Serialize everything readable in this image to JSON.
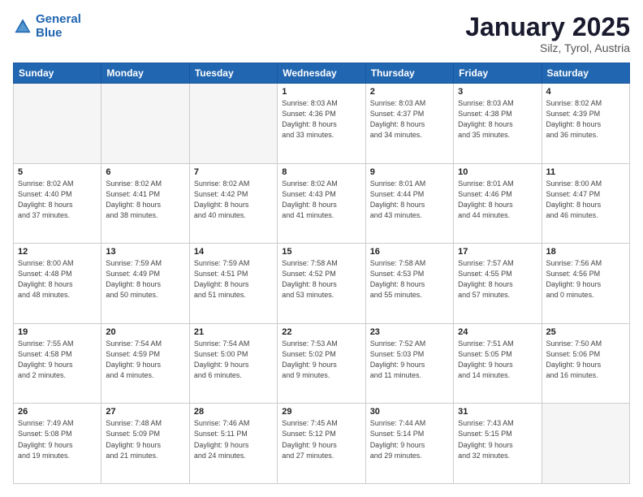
{
  "header": {
    "logo_line1": "General",
    "logo_line2": "Blue",
    "month": "January 2025",
    "location": "Silz, Tyrol, Austria"
  },
  "days_of_week": [
    "Sunday",
    "Monday",
    "Tuesday",
    "Wednesday",
    "Thursday",
    "Friday",
    "Saturday"
  ],
  "weeks": [
    [
      {
        "num": "",
        "detail": "",
        "empty": true
      },
      {
        "num": "",
        "detail": "",
        "empty": true
      },
      {
        "num": "",
        "detail": "",
        "empty": true
      },
      {
        "num": "1",
        "detail": "Sunrise: 8:03 AM\nSunset: 4:36 PM\nDaylight: 8 hours\nand 33 minutes.",
        "empty": false
      },
      {
        "num": "2",
        "detail": "Sunrise: 8:03 AM\nSunset: 4:37 PM\nDaylight: 8 hours\nand 34 minutes.",
        "empty": false
      },
      {
        "num": "3",
        "detail": "Sunrise: 8:03 AM\nSunset: 4:38 PM\nDaylight: 8 hours\nand 35 minutes.",
        "empty": false
      },
      {
        "num": "4",
        "detail": "Sunrise: 8:02 AM\nSunset: 4:39 PM\nDaylight: 8 hours\nand 36 minutes.",
        "empty": false
      }
    ],
    [
      {
        "num": "5",
        "detail": "Sunrise: 8:02 AM\nSunset: 4:40 PM\nDaylight: 8 hours\nand 37 minutes.",
        "empty": false
      },
      {
        "num": "6",
        "detail": "Sunrise: 8:02 AM\nSunset: 4:41 PM\nDaylight: 8 hours\nand 38 minutes.",
        "empty": false
      },
      {
        "num": "7",
        "detail": "Sunrise: 8:02 AM\nSunset: 4:42 PM\nDaylight: 8 hours\nand 40 minutes.",
        "empty": false
      },
      {
        "num": "8",
        "detail": "Sunrise: 8:02 AM\nSunset: 4:43 PM\nDaylight: 8 hours\nand 41 minutes.",
        "empty": false
      },
      {
        "num": "9",
        "detail": "Sunrise: 8:01 AM\nSunset: 4:44 PM\nDaylight: 8 hours\nand 43 minutes.",
        "empty": false
      },
      {
        "num": "10",
        "detail": "Sunrise: 8:01 AM\nSunset: 4:46 PM\nDaylight: 8 hours\nand 44 minutes.",
        "empty": false
      },
      {
        "num": "11",
        "detail": "Sunrise: 8:00 AM\nSunset: 4:47 PM\nDaylight: 8 hours\nand 46 minutes.",
        "empty": false
      }
    ],
    [
      {
        "num": "12",
        "detail": "Sunrise: 8:00 AM\nSunset: 4:48 PM\nDaylight: 8 hours\nand 48 minutes.",
        "empty": false
      },
      {
        "num": "13",
        "detail": "Sunrise: 7:59 AM\nSunset: 4:49 PM\nDaylight: 8 hours\nand 50 minutes.",
        "empty": false
      },
      {
        "num": "14",
        "detail": "Sunrise: 7:59 AM\nSunset: 4:51 PM\nDaylight: 8 hours\nand 51 minutes.",
        "empty": false
      },
      {
        "num": "15",
        "detail": "Sunrise: 7:58 AM\nSunset: 4:52 PM\nDaylight: 8 hours\nand 53 minutes.",
        "empty": false
      },
      {
        "num": "16",
        "detail": "Sunrise: 7:58 AM\nSunset: 4:53 PM\nDaylight: 8 hours\nand 55 minutes.",
        "empty": false
      },
      {
        "num": "17",
        "detail": "Sunrise: 7:57 AM\nSunset: 4:55 PM\nDaylight: 8 hours\nand 57 minutes.",
        "empty": false
      },
      {
        "num": "18",
        "detail": "Sunrise: 7:56 AM\nSunset: 4:56 PM\nDaylight: 9 hours\nand 0 minutes.",
        "empty": false
      }
    ],
    [
      {
        "num": "19",
        "detail": "Sunrise: 7:55 AM\nSunset: 4:58 PM\nDaylight: 9 hours\nand 2 minutes.",
        "empty": false
      },
      {
        "num": "20",
        "detail": "Sunrise: 7:54 AM\nSunset: 4:59 PM\nDaylight: 9 hours\nand 4 minutes.",
        "empty": false
      },
      {
        "num": "21",
        "detail": "Sunrise: 7:54 AM\nSunset: 5:00 PM\nDaylight: 9 hours\nand 6 minutes.",
        "empty": false
      },
      {
        "num": "22",
        "detail": "Sunrise: 7:53 AM\nSunset: 5:02 PM\nDaylight: 9 hours\nand 9 minutes.",
        "empty": false
      },
      {
        "num": "23",
        "detail": "Sunrise: 7:52 AM\nSunset: 5:03 PM\nDaylight: 9 hours\nand 11 minutes.",
        "empty": false
      },
      {
        "num": "24",
        "detail": "Sunrise: 7:51 AM\nSunset: 5:05 PM\nDaylight: 9 hours\nand 14 minutes.",
        "empty": false
      },
      {
        "num": "25",
        "detail": "Sunrise: 7:50 AM\nSunset: 5:06 PM\nDaylight: 9 hours\nand 16 minutes.",
        "empty": false
      }
    ],
    [
      {
        "num": "26",
        "detail": "Sunrise: 7:49 AM\nSunset: 5:08 PM\nDaylight: 9 hours\nand 19 minutes.",
        "empty": false
      },
      {
        "num": "27",
        "detail": "Sunrise: 7:48 AM\nSunset: 5:09 PM\nDaylight: 9 hours\nand 21 minutes.",
        "empty": false
      },
      {
        "num": "28",
        "detail": "Sunrise: 7:46 AM\nSunset: 5:11 PM\nDaylight: 9 hours\nand 24 minutes.",
        "empty": false
      },
      {
        "num": "29",
        "detail": "Sunrise: 7:45 AM\nSunset: 5:12 PM\nDaylight: 9 hours\nand 27 minutes.",
        "empty": false
      },
      {
        "num": "30",
        "detail": "Sunrise: 7:44 AM\nSunset: 5:14 PM\nDaylight: 9 hours\nand 29 minutes.",
        "empty": false
      },
      {
        "num": "31",
        "detail": "Sunrise: 7:43 AM\nSunset: 5:15 PM\nDaylight: 9 hours\nand 32 minutes.",
        "empty": false
      },
      {
        "num": "",
        "detail": "",
        "empty": true
      }
    ]
  ]
}
